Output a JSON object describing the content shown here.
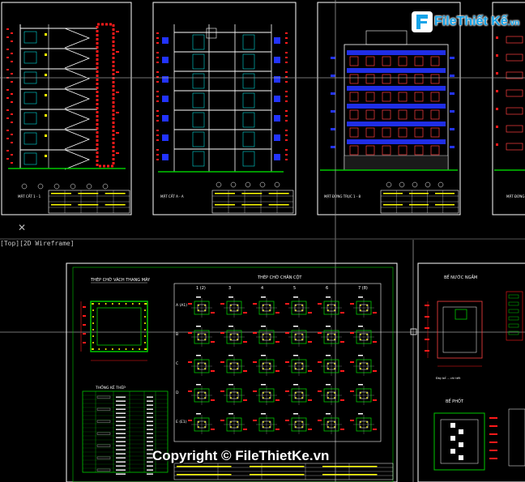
{
  "viewport": {
    "label": "[Top][2D Wireframe]"
  },
  "close_glyph": "✕",
  "watermark": {
    "logo_name": "File",
    "logo_accent": "Thiết Kế",
    "logo_tld": ".vn",
    "copyright": "Copyright © FileThietKe.vn"
  },
  "sheets": {
    "section_1": {
      "title": "MẶT CẮT 1 - 1"
    },
    "section_2": {
      "title": "MẶT CẮT A - A"
    },
    "elevation": {
      "title": "MẶT ĐỨNG TRỤC 1 - 8"
    },
    "elevation_2": {
      "title": "MẶT ĐỨNG"
    }
  },
  "steel_sheet": {
    "elevator_title": "THÉP CHỜ VÁCH THANG MÁY",
    "columns_title": "THÉP CHỜ CHÂN CỘT",
    "stats_title": "THỐNG KÊ THÉP",
    "grid_cols": [
      "1 (2)",
      "3",
      "4",
      "5",
      "6",
      "7 (8)"
    ],
    "grid_rows": [
      "A (A1)",
      "B",
      "C",
      "D",
      "E (E1)"
    ]
  },
  "tank_sheet": {
    "tank_title": "BỂ NƯỚC NGẦM",
    "footing_title": "BỂ PHỐT",
    "tank_note": "Đáy bể ... chi tiết"
  },
  "colors": {
    "red": "#ff1a1a",
    "yellow": "#ffff00",
    "green": "#00c800",
    "blue": "#2233ff",
    "white": "#ffffff",
    "cyan": "#00ffff"
  }
}
